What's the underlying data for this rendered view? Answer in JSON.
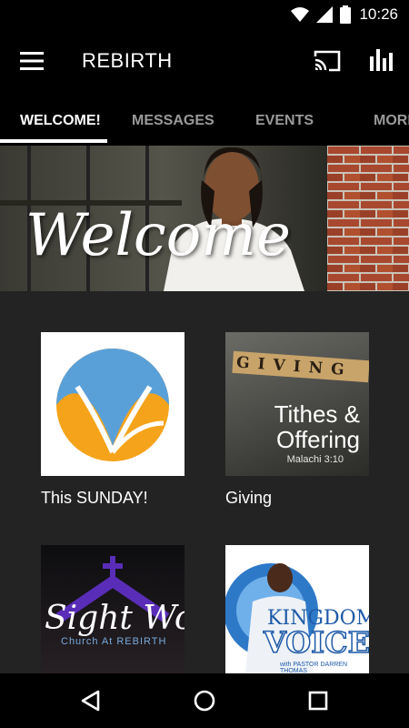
{
  "status": {
    "time": "10:26"
  },
  "app": {
    "title": "REBIRTH"
  },
  "tabs": [
    {
      "label": "WELCOME!"
    },
    {
      "label": "MESSAGES"
    },
    {
      "label": "EVENTS"
    },
    {
      "label": "MORE"
    }
  ],
  "banner": {
    "text": "Welcome"
  },
  "tiles": [
    {
      "label": "This SUNDAY!"
    },
    {
      "label": "Giving",
      "image_text": {
        "word": "GIVING",
        "title_line1": "Tithes &",
        "title_line2": "Offering",
        "verse": "Malachi 3:10"
      }
    },
    {
      "label": "",
      "image_text": {
        "line1": "Sight Word",
        "line2": "Church At REBIRTH"
      }
    },
    {
      "label": "",
      "image_text": {
        "line1": "KINGDOM",
        "line2": "VOICE",
        "line3": "with PASTOR DARREN THOMAS"
      }
    }
  ],
  "colors": {
    "accent_orange": "#f5a31a",
    "accent_blue": "#4a90d9",
    "background": "#232323"
  }
}
